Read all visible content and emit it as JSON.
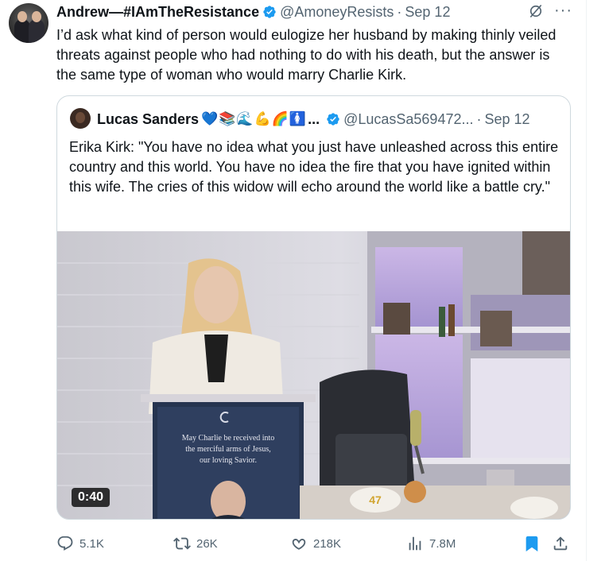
{
  "tweet": {
    "author_name": "Andrew—#IAmTheResistance",
    "handle": "@AmoneyResists",
    "separator": "·",
    "date": "Sep 12",
    "more": "···",
    "text": "I’d ask what kind of person would eulogize her husband by making thinly veiled threats against people who had nothing to do with his death, but the answer is the same type of woman who would marry Charlie Kirk."
  },
  "quote": {
    "author_name": "Lucas Sanders",
    "emojis": "💙📚🌊💪🌈🚺",
    "ellipsis": "...",
    "handle": "@LucasSa569472...",
    "separator": "·",
    "date": "Sep 12",
    "text": "Erika Kirk: \"You have no idea what you just have unleashed across this entire country and this world. You have no idea the fire that you have ignited within this wife. The cries of this widow will echo around the world like a battle cry.\"",
    "video": {
      "duration": "0:40",
      "sign_text": [
        "May Charlie be received into",
        "the merciful arms of Jesus,",
        "our loving Savior."
      ],
      "hat_text": "47"
    }
  },
  "actions": {
    "replies": "5.1K",
    "reposts": "26K",
    "likes": "218K",
    "views": "7.8M"
  },
  "colors": {
    "text": "#0f1419",
    "muted": "#536471",
    "verified": "#1d9bf0",
    "bookmark": "#1d9bf0",
    "border": "#cfd9de"
  }
}
